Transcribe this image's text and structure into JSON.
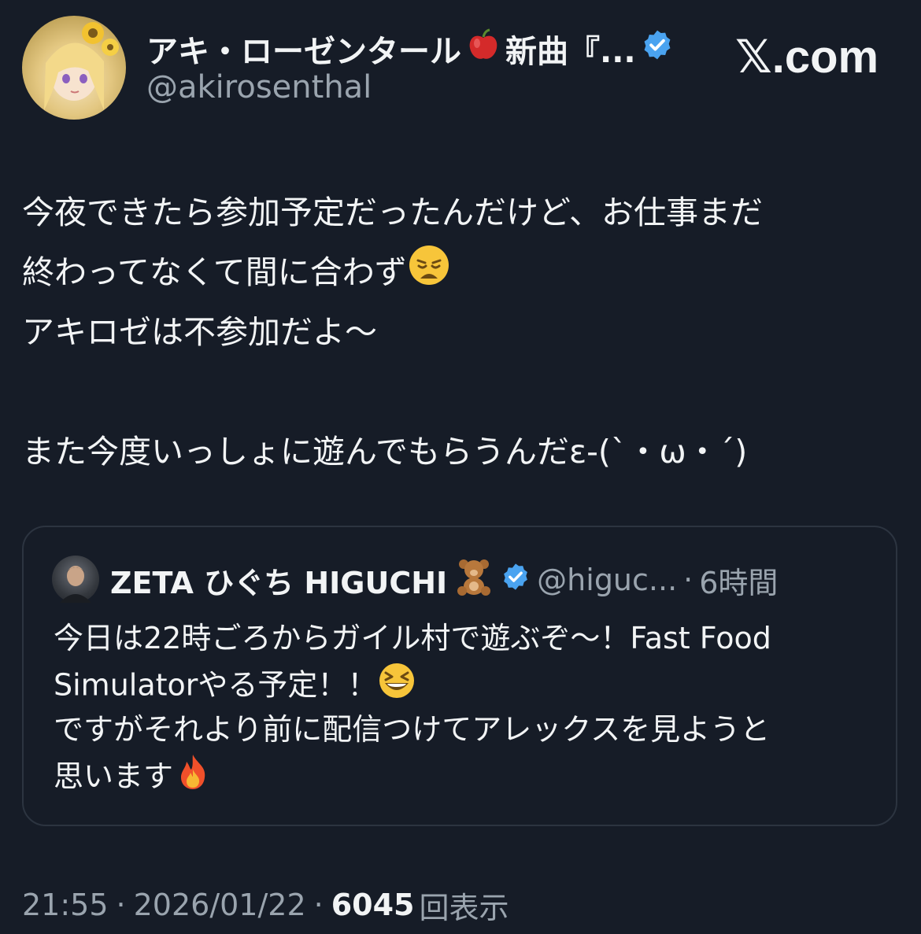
{
  "author": {
    "name": "アキ・ローゼンタール",
    "name_emoji_icon": "apple-icon",
    "name_suffix": "新曲『...",
    "handle": "@akirosenthal",
    "verified": true
  },
  "site": {
    "label": "𝕏.com"
  },
  "post": {
    "lines": [
      "今夜できたら参加予定だったんだけど、お仕事まだ",
      "終わってなくて間に合わず",
      "アキロゼは不参加だよ〜",
      "",
      "また今度いっしょに遊んでもらうんだε-(`・ω・´)"
    ],
    "line2_emoji_icon": "weary-face-icon"
  },
  "quoted": {
    "name": "ZETA ひぐち HIGUCHI",
    "name_emoji_icon": "teddy-bear-icon",
    "handle": "@higuc...",
    "separator": "·",
    "time": "6時間",
    "lines": [
      "今日は22時ごろからガイル村で遊ぶぞ〜！Fast Food",
      "Simulatorやる予定！！",
      "ですがそれより前に配信つけてアレックスを見ようと",
      "思います"
    ],
    "line2_emoji_icon": "grinning-squinting-face-icon",
    "line4_emoji_icon": "fire-icon"
  },
  "meta": {
    "time": "21:55",
    "separator": "·",
    "date": "2026/01/22",
    "views": "6045",
    "views_label": "回表示"
  },
  "colors": {
    "background": "#161c27",
    "text": "#f2f4f5",
    "muted": "#9aa4ae",
    "verified": "#4aa3f0",
    "border": "#2c3440"
  }
}
